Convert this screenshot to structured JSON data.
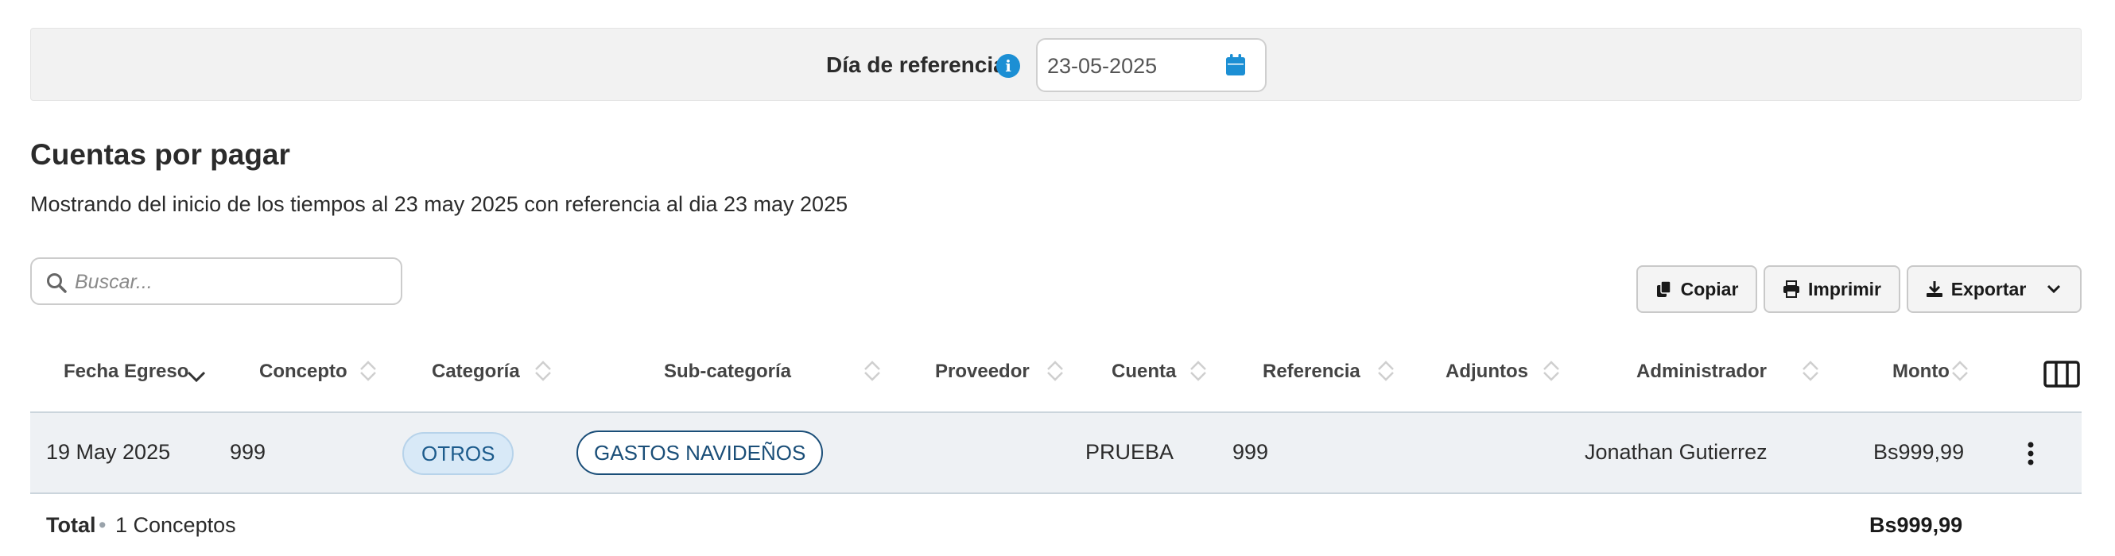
{
  "reference_bar": {
    "label": "Día de referencia:",
    "date_value": "23-05-2025"
  },
  "page": {
    "title": "Cuentas por pagar",
    "subtitle": "Mostrando del inicio de los tiempos al 23 may 2025 con referencia al dia 23 may 2025"
  },
  "search": {
    "placeholder": "Buscar..."
  },
  "toolbar": {
    "copy_label": "Copiar",
    "print_label": "Imprimir",
    "export_label": "Exportar"
  },
  "table": {
    "columns": [
      "Fecha Egreso",
      "Concepto",
      "Categoría",
      "Sub-categoría",
      "Proveedor",
      "Cuenta",
      "Referencia",
      "Adjuntos",
      "Administrador",
      "Monto"
    ],
    "rows": [
      {
        "fecha": "19 May 2025",
        "concepto": "999",
        "categoria": "OTROS",
        "subcategoria": "GASTOS NAVIDEÑOS",
        "proveedor": "",
        "cuenta": "PRUEBA",
        "referencia": "999",
        "adjuntos": "",
        "administrador": "Jonathan Gutierrez",
        "monto": "Bs999,99"
      }
    ],
    "footer": {
      "total_label": "Total",
      "separator": "•",
      "count_label": "1 Conceptos",
      "sum": "Bs999,99"
    }
  },
  "colors": {
    "accent": "#1c8fd4",
    "pill_outline": "#1a4e78",
    "row_bg": "#eef1f4"
  }
}
